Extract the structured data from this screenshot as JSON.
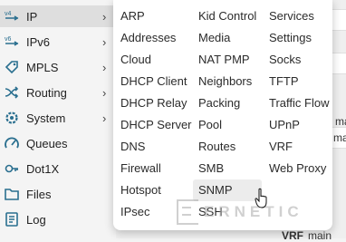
{
  "sidebar": {
    "items": [
      {
        "label": "IP",
        "icon": "ip-icon",
        "has_submenu": true,
        "active": true
      },
      {
        "label": "IPv6",
        "icon": "ipv6-icon",
        "has_submenu": true
      },
      {
        "label": "MPLS",
        "icon": "mpls-icon",
        "has_submenu": true
      },
      {
        "label": "Routing",
        "icon": "routing-icon",
        "has_submenu": true
      },
      {
        "label": "System",
        "icon": "system-icon",
        "has_submenu": true
      },
      {
        "label": "Queues",
        "icon": "queues-icon"
      },
      {
        "label": "Dot1X",
        "icon": "dot1x-icon"
      },
      {
        "label": "Files",
        "icon": "files-icon"
      },
      {
        "label": "Log",
        "icon": "log-icon"
      }
    ],
    "chevron": "›"
  },
  "ip_menu": {
    "col1": [
      "ARP",
      "Addresses",
      "Cloud",
      "DHCP Client",
      "DHCP Relay",
      "DHCP Server",
      "DNS",
      "Firewall",
      "Hotspot",
      "IPsec"
    ],
    "col2": [
      "Kid Control",
      "Media",
      "NAT PMP",
      "Neighbors",
      "Packing",
      "Pool",
      "Routes",
      "SMB",
      "SNMP",
      "SSH"
    ],
    "col3": [
      "Services",
      "Settings",
      "Socks",
      "TFTP",
      "Traffic Flow",
      "UPnP",
      "VRF",
      "Web Proxy"
    ],
    "hovered": "SNMP"
  },
  "background": {
    "text_main_1": "ma",
    "text_main_2": "main",
    "text_vrf": "VRF",
    "text_main_3": "main"
  },
  "watermark": {
    "text": "ERNETIC"
  },
  "colors": {
    "accent_bg": "#dedede",
    "menu_bg": "#ffffff",
    "hover_bg": "#ececec"
  }
}
